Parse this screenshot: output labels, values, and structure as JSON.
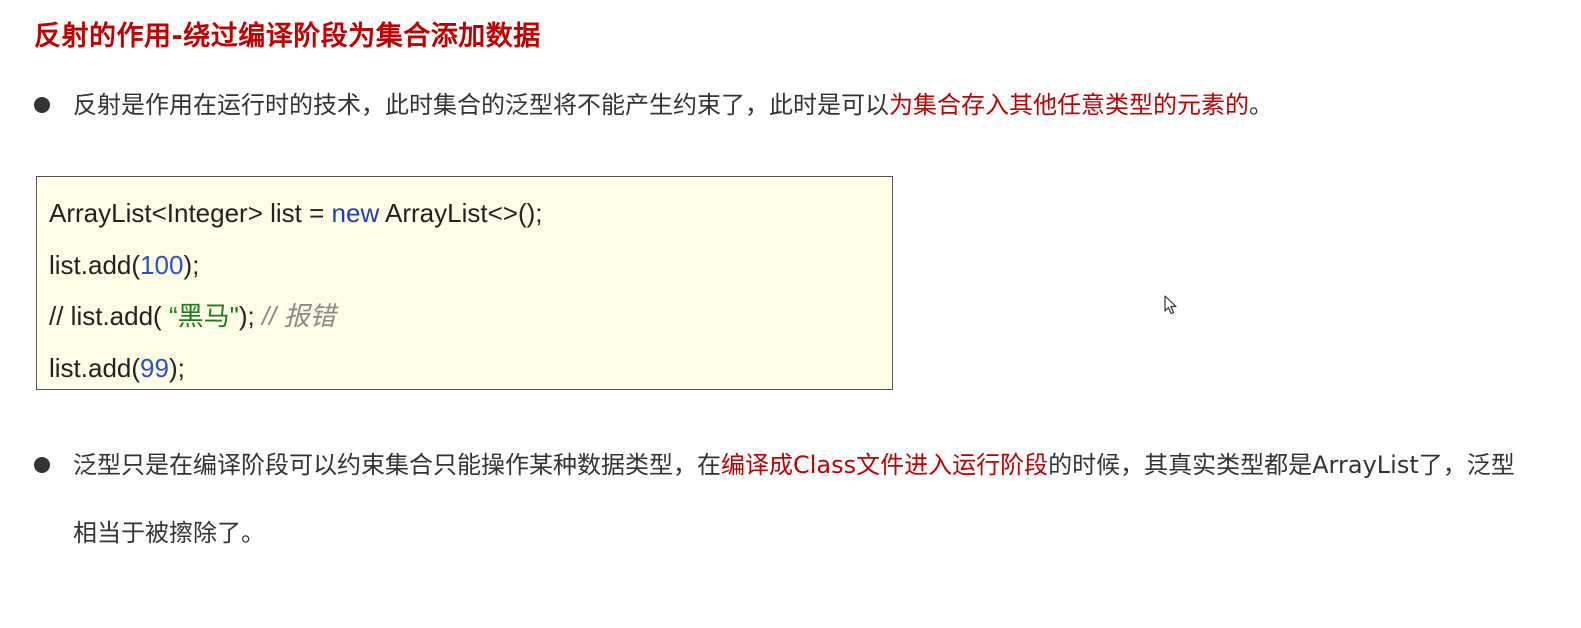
{
  "title": "反射的作用-绕过编译阶段为集合添加数据",
  "bullet1": {
    "prefix": "反射是作用在运行时的技术，此时集合的泛型将不能产生约束了，此时是可以",
    "highlight": "为集合存入其他任意类型的元素的",
    "suffix": "。"
  },
  "code": {
    "line1": {
      "a": "ArrayList<Integer> list = ",
      "kw": "new",
      "b": " ArrayList<>();"
    },
    "line2": {
      "a": "list.add(",
      "num": "100",
      "b": ");"
    },
    "line3": {
      "a": "// list.add( ",
      "str": "“黑马\"",
      "b": "); ",
      "cmt": "// 报错"
    },
    "line4": {
      "a": "list.add(",
      "num": "99",
      "b": ");"
    }
  },
  "bullet2": {
    "prefix": "泛型只是在编译阶段可以约束集合只能操作某种数据类型，在",
    "highlight": "编译成Class文件进入运行阶段",
    "suffix": "的时候，其真实类型都是ArrayList了，泛型相当于被擦除了。"
  },
  "colors": {
    "accent_red": "#c00000",
    "code_background": "#fefee6",
    "keyword": "#1f3fb8",
    "string": "#1e7a1e",
    "comment": "#8a8a8a"
  },
  "icons": {
    "cursor": "mouse-pointer-icon"
  }
}
